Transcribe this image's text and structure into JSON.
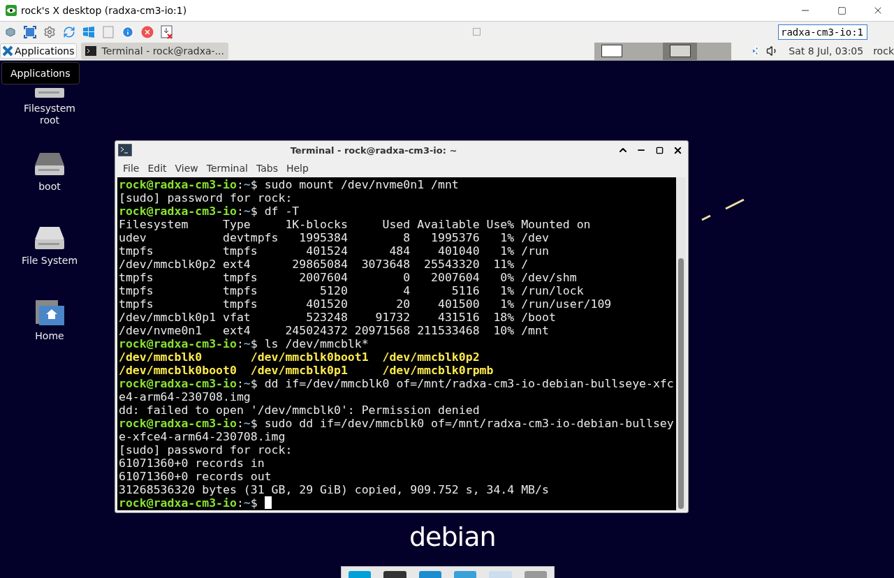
{
  "viewer": {
    "title": "rock's X desktop (radxa-cm3-io:1)",
    "host_field": {
      "value": "radxa-cm3-io:1"
    }
  },
  "panel": {
    "applications": "Applications",
    "tasks": [
      {
        "label": "Terminal - rock@radxa-...",
        "selected": true
      }
    ],
    "workspaces": [
      {
        "selected": false
      },
      {
        "selected": false
      },
      {
        "selected": true
      },
      {
        "selected": false
      }
    ],
    "clock": "Sat  8 Jul, 03:05",
    "user": "rock"
  },
  "tooltip": "Applications",
  "desktop_icons": [
    {
      "kind": "drive",
      "label": "Filesystem root"
    },
    {
      "kind": "drive",
      "label": "boot"
    },
    {
      "kind": "disk",
      "label": "File System"
    },
    {
      "kind": "home",
      "label": "Home"
    }
  ],
  "terminal": {
    "title": "Terminal - rock@radxa-cm3-io: ~",
    "menu": [
      "File",
      "Edit",
      "View",
      "Terminal",
      "Tabs",
      "Help"
    ],
    "lines": [
      {
        "kind": "prompt",
        "user": "rock@radxa-cm3-io",
        "sep": ":",
        "path": "~",
        "symbol": "$",
        "text": " sudo mount /dev/nvme0n1 /mnt"
      },
      {
        "kind": "output",
        "text": "[sudo] password for rock:"
      },
      {
        "kind": "prompt",
        "user": "rock@radxa-cm3-io",
        "sep": ":",
        "path": "~",
        "symbol": "$",
        "text": " df -T"
      },
      {
        "kind": "output",
        "text": "Filesystem     Type     1K-blocks     Used Available Use% Mounted on"
      },
      {
        "kind": "output",
        "text": "udev           devtmpfs   1995384        8   1995376   1% /dev"
      },
      {
        "kind": "output",
        "text": "tmpfs          tmpfs       401524      484    401040   1% /run"
      },
      {
        "kind": "output",
        "text": "/dev/mmcblk0p2 ext4      29865084  3073648  25543320  11% /"
      },
      {
        "kind": "output",
        "text": "tmpfs          tmpfs      2007604        0   2007604   0% /dev/shm"
      },
      {
        "kind": "output",
        "text": "tmpfs          tmpfs         5120        4      5116   1% /run/lock"
      },
      {
        "kind": "output",
        "text": "tmpfs          tmpfs       401520       20    401500   1% /run/user/109"
      },
      {
        "kind": "output",
        "text": "/dev/mmcblk0p1 vfat        523248    91732    431516  18% /boot"
      },
      {
        "kind": "output",
        "text": "/dev/nvme0n1   ext4     245024372 20971568 211533468  10% /mnt"
      },
      {
        "kind": "prompt",
        "user": "rock@radxa-cm3-io",
        "sep": ":",
        "path": "~",
        "symbol": "$",
        "text": " ls /dev/mmcblk*"
      },
      {
        "kind": "listing",
        "text": "/dev/mmcblk0       /dev/mmcblk0boot1  /dev/mmcblk0p2"
      },
      {
        "kind": "listing",
        "text": "/dev/mmcblk0boot0  /dev/mmcblk0p1     /dev/mmcblk0rpmb"
      },
      {
        "kind": "prompt",
        "user": "rock@radxa-cm3-io",
        "sep": ":",
        "path": "~",
        "symbol": "$",
        "text": " dd if=/dev/mmcblk0 of=/mnt/radxa-cm3-io-debian-bullseye-xfc"
      },
      {
        "kind": "output",
        "text": "e4-arm64-230708.img"
      },
      {
        "kind": "output",
        "text": "dd: failed to open '/dev/mmcblk0': Permission denied"
      },
      {
        "kind": "prompt",
        "user": "rock@radxa-cm3-io",
        "sep": ":",
        "path": "~",
        "symbol": "$",
        "text": " sudo dd if=/dev/mmcblk0 of=/mnt/radxa-cm3-io-debian-bullsey"
      },
      {
        "kind": "output",
        "text": "e-xfce4-arm64-230708.img"
      },
      {
        "kind": "output",
        "text": "[sudo] password for rock:"
      },
      {
        "kind": "output",
        "text": "61071360+0 records in"
      },
      {
        "kind": "output",
        "text": "61071360+0 records out"
      },
      {
        "kind": "output",
        "text": "31268536320 bytes (31 GB, 29 GiB) copied, 909.752 s, 34.4 MB/s"
      },
      {
        "kind": "prompt",
        "user": "rock@radxa-cm3-io",
        "sep": ":",
        "path": "~",
        "symbol": "$",
        "cursor": true
      }
    ]
  },
  "wallpaper_logo": "debian"
}
